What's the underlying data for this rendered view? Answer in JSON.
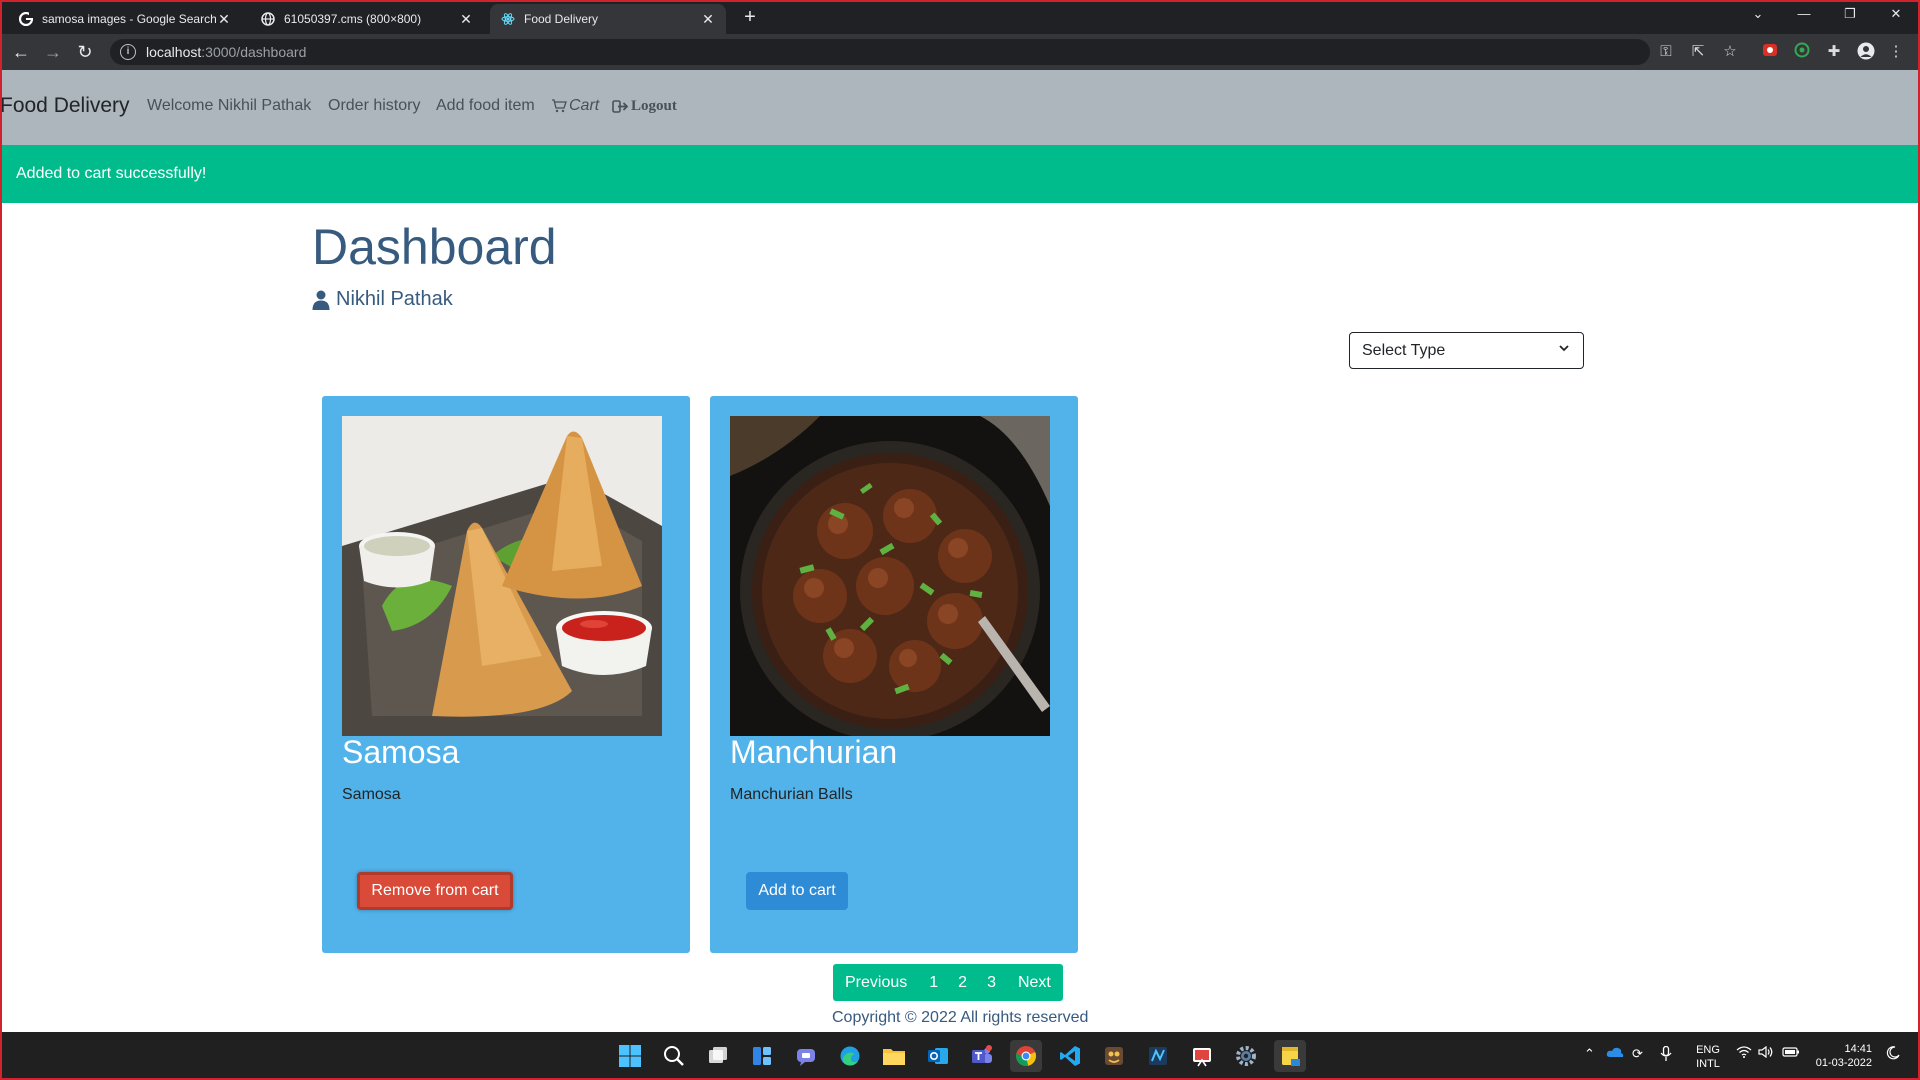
{
  "browser": {
    "tabs": [
      {
        "title": "samosa images - Google Search",
        "icon": "google-icon",
        "active": false
      },
      {
        "title": "61050397.cms (800×800)",
        "icon": "globe-icon",
        "active": false
      },
      {
        "title": "Food Delivery",
        "icon": "react-icon",
        "active": true
      }
    ],
    "url_host": "localhost",
    "url_path": ":3000/dashboard"
  },
  "navbar": {
    "brand": "Food Delivery",
    "welcome": "Welcome Nikhil Pathak",
    "order_history": "Order history",
    "add_food_item": "Add food item",
    "cart": "Cart",
    "logout": "Logout"
  },
  "alert": {
    "message": "Added to cart successfully!",
    "color": "#00bc8c"
  },
  "dashboard": {
    "title": "Dashboard",
    "user_name": "Nikhil Pathak",
    "filter_placeholder": "Select Type"
  },
  "cards": [
    {
      "title": "Samosa",
      "description": "Samosa",
      "button": "Remove from cart",
      "button_color": "#d94a38"
    },
    {
      "title": "Manchurian",
      "description": "Manchurian Balls",
      "button": "Add to cart",
      "button_color": "#2e8bd6"
    }
  ],
  "pagination": {
    "previous": "Previous",
    "pages": [
      "1",
      "2",
      "3"
    ],
    "next": "Next"
  },
  "footer": {
    "copyright": "Copyright © 2022 All rights reserved"
  },
  "taskbar": {
    "language": "ENG",
    "layout": "INTL",
    "time": "14:41",
    "date": "01-03-2022"
  }
}
